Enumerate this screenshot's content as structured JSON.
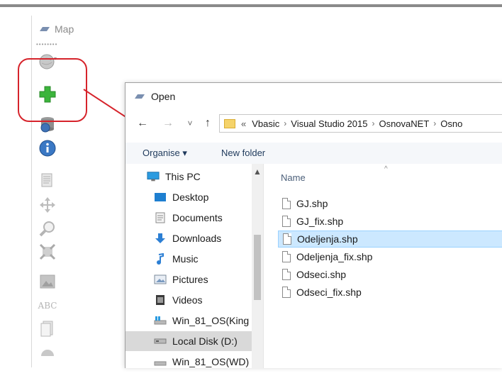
{
  "map_window": {
    "title": "Map"
  },
  "toolbar": {
    "tools": [
      {
        "icon": "globe-icon"
      },
      {
        "icon": "add-layer-plus-icon"
      },
      {
        "icon": "database-globe-icon"
      },
      {
        "icon": "info-icon"
      },
      {
        "icon": "layers-icon"
      },
      {
        "icon": "pan-icon"
      },
      {
        "icon": "zoom-icon"
      },
      {
        "icon": "full-extent-icon"
      },
      {
        "icon": "image-icon"
      },
      {
        "icon": "label-abc-icon"
      },
      {
        "icon": "document-icon"
      }
    ],
    "abc_label": "ABC"
  },
  "open_dialog": {
    "title": "Open",
    "nav": {
      "back": "←",
      "forward": "→",
      "recent": "˅",
      "up": "↑"
    },
    "address": {
      "overflow": "«",
      "crumbs": [
        "Vbasic",
        "Visual Studio 2015",
        "OsnovaNET",
        "Osno"
      ]
    },
    "command_bar": {
      "organise": "Organise ▾",
      "new_folder": "New folder"
    },
    "nav_pane": {
      "items": [
        {
          "label": "This PC",
          "icon": "pc-icon"
        },
        {
          "label": "Desktop",
          "icon": "desktop-icon"
        },
        {
          "label": "Documents",
          "icon": "documents-icon"
        },
        {
          "label": "Downloads",
          "icon": "download-icon"
        },
        {
          "label": "Music",
          "icon": "music-icon"
        },
        {
          "label": "Pictures",
          "icon": "pictures-icon"
        },
        {
          "label": "Videos",
          "icon": "videos-icon"
        },
        {
          "label": "Win_81_OS(King",
          "icon": "network-drive-icon"
        },
        {
          "label": "Local Disk (D:)",
          "icon": "disk-icon",
          "selected": true
        },
        {
          "label": "Win_81_OS(WD)",
          "icon": "network-drive-icon"
        }
      ]
    },
    "file_pane": {
      "column_name": "Name",
      "files": [
        "GJ.shp",
        "GJ_fix.shp",
        "Odeljenja.shp",
        "Odeljenja_fix.shp",
        "Odseci.shp",
        "Odseci_fix.shp"
      ],
      "selected_index": 2
    }
  },
  "colors": {
    "callout": "#d6232b",
    "selection": "#cce8ff",
    "plus": "#3cb43c"
  }
}
